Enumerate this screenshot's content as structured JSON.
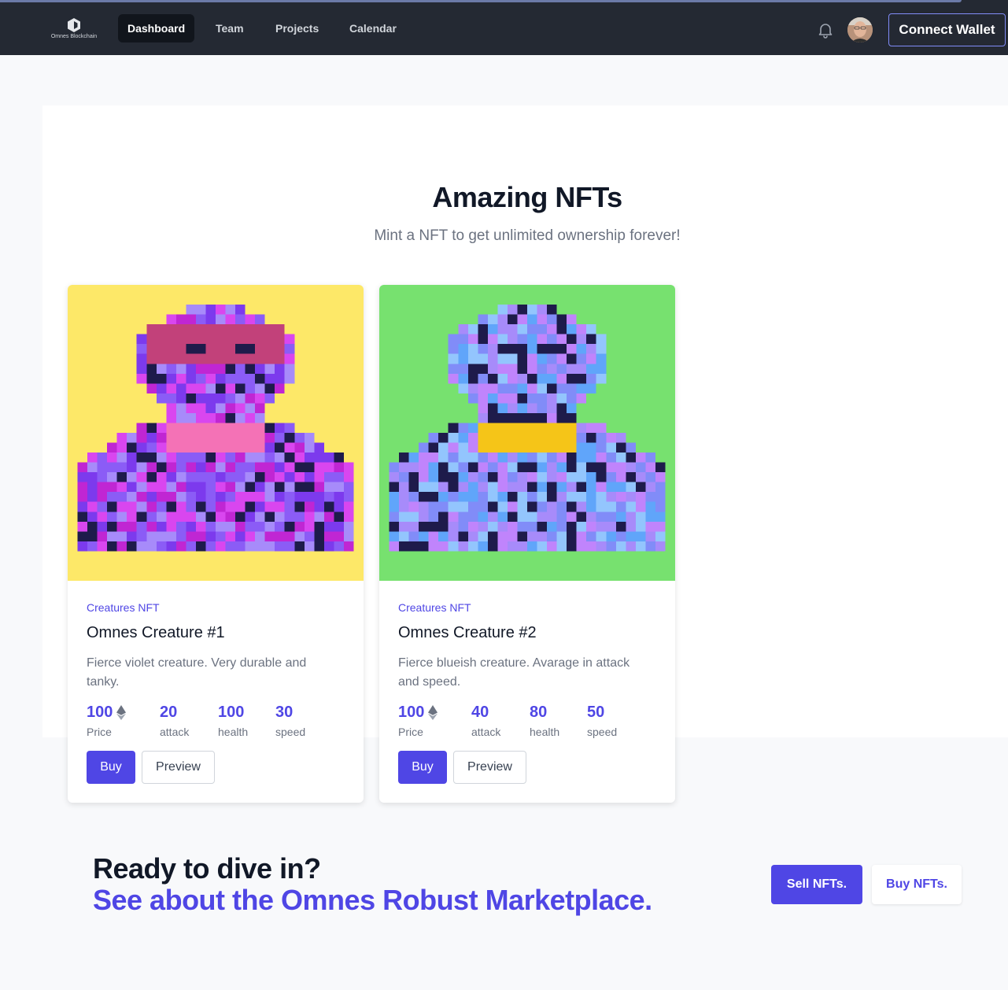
{
  "brand": {
    "logo_text": "Omnes Blockchain"
  },
  "nav": {
    "links": [
      {
        "label": "Dashboard",
        "active": true
      },
      {
        "label": "Team",
        "active": false
      },
      {
        "label": "Projects",
        "active": false
      },
      {
        "label": "Calendar",
        "active": false
      }
    ],
    "icons": [
      "bell-icon",
      "user-avatar"
    ],
    "connect_wallet": "Connect Wallet"
  },
  "hero": {
    "title": "Amazing NFTs",
    "subtitle": "Mint a NFT to get unlimited ownership forever!"
  },
  "cards": [
    {
      "category": "Creatures NFT",
      "name": "Omnes Creature #1",
      "description": "Fierce violet creature. Very durable and tanky.",
      "background": "#fde868",
      "stats": [
        {
          "value": "100",
          "label": "Price",
          "icon": "ethereum-icon"
        },
        {
          "value": "20",
          "label": "attack"
        },
        {
          "value": "100",
          "label": "health"
        },
        {
          "value": "30",
          "label": "speed"
        }
      ],
      "buy": "Buy",
      "preview": "Preview"
    },
    {
      "category": "Creatures NFT",
      "name": "Omnes Creature #2",
      "description": "Fierce blueish creature. Avarage in attack and speed.",
      "background": "#77e16f",
      "stats": [
        {
          "value": "100",
          "label": "Price",
          "icon": "ethereum-icon"
        },
        {
          "value": "40",
          "label": "attack"
        },
        {
          "value": "80",
          "label": "health"
        },
        {
          "value": "50",
          "label": "speed"
        }
      ],
      "buy": "Buy",
      "preview": "Preview"
    }
  ],
  "cta": {
    "line1": "Ready to dive in?",
    "line2": "See about the Omnes Robust Marketplace.",
    "sell": "Sell NFTs.",
    "buy": "Buy NFTs."
  },
  "colors": {
    "accent": "#4f46e5",
    "navbar": "#242933",
    "dark": "#111827"
  }
}
